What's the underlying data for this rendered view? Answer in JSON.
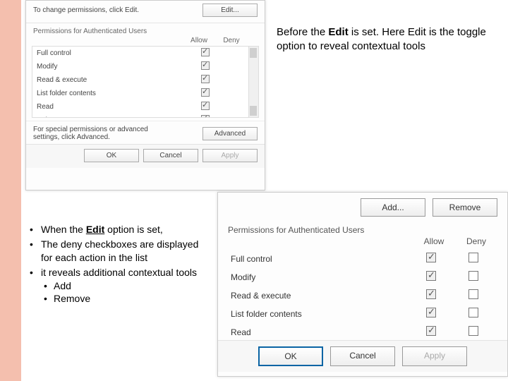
{
  "annot_top": {
    "t1": "Before the ",
    "bold1": "Edit",
    "t2": " is set. Here Edit is the toggle option to reveal contextual tools"
  },
  "dialog_top": {
    "change_text": "To change permissions, click Edit.",
    "edit_btn": "Edit...",
    "perm_label": "Permissions for Authenticated Users",
    "col_allow": "Allow",
    "col_deny": "Deny",
    "rows": [
      {
        "name": "Full control"
      },
      {
        "name": "Modify"
      },
      {
        "name": "Read & execute"
      },
      {
        "name": "List folder contents"
      },
      {
        "name": "Read"
      },
      {
        "name": "Write"
      }
    ],
    "adv_text": "For special permissions or advanced settings, click Advanced.",
    "adv_btn": "Advanced",
    "ok": "OK",
    "cancel": "Cancel",
    "apply": "Apply"
  },
  "bullets": {
    "b1a": "When the ",
    "b1b": "Edit",
    "b1c": " option is set,",
    "b2": "The deny checkboxes are displayed for each action in the list",
    "b3": "it reveals additional contextual tools",
    "s1": "Add",
    "s2": "Remove"
  },
  "dialog_bot": {
    "add_btn": "Add...",
    "remove_btn": "Remove",
    "perm_label": "Permissions for Authenticated Users",
    "col_allow": "Allow",
    "col_deny": "Deny",
    "rows": [
      {
        "name": "Full control"
      },
      {
        "name": "Modify"
      },
      {
        "name": "Read & execute"
      },
      {
        "name": "List folder contents"
      },
      {
        "name": "Read"
      }
    ],
    "ok": "OK",
    "cancel": "Cancel",
    "apply": "Apply"
  }
}
